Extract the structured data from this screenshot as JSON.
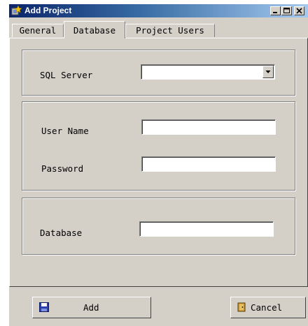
{
  "window": {
    "title": "Add Project",
    "title_icon": "project-wizard-icon",
    "controls": {
      "minimize": "minimize-icon",
      "maximize": "maximize-icon",
      "close": "close-icon"
    }
  },
  "tabs": [
    {
      "label": "General",
      "active": false
    },
    {
      "label": "Database",
      "active": true
    },
    {
      "label": "Project Users",
      "active": false
    }
  ],
  "form": {
    "sql_server": {
      "label": "SQL Server",
      "value": ""
    },
    "user_name": {
      "label": "User Name",
      "value": ""
    },
    "password": {
      "label": "Password",
      "value": ""
    },
    "database": {
      "label": "Database",
      "value": ""
    }
  },
  "buttons": {
    "add": {
      "label": "Add",
      "icon": "floppy-disk-icon"
    },
    "cancel": {
      "label": "Cancel",
      "icon": "exit-door-icon"
    }
  }
}
